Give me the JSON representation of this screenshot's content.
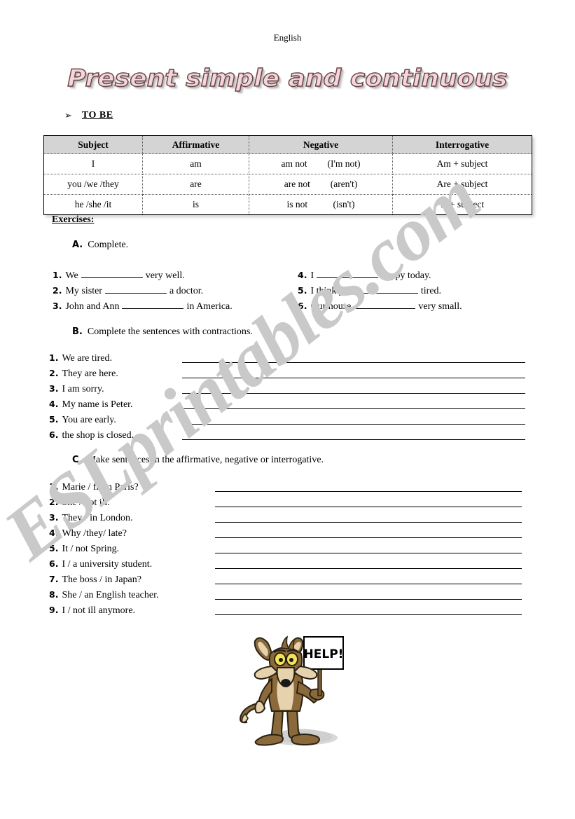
{
  "page": {
    "header_label": "English",
    "title": "Present simple and continuous",
    "watermark": "ESLprintables.com"
  },
  "grammar_section": {
    "bullet_glyph": "➢",
    "label": "TO BE",
    "table": {
      "headers": [
        "Subject",
        "Affirmative",
        "Negative",
        "Interrogative"
      ],
      "rows": [
        {
          "subject": "I",
          "affirmative": "am",
          "negative": "am not",
          "negative_contraction": "(I'm not)",
          "interrogative": "Am + subject"
        },
        {
          "subject": "you /we /they",
          "affirmative": "are",
          "negative": "are not",
          "negative_contraction": "(aren't)",
          "interrogative": "Are + subject"
        },
        {
          "subject": "he /she /it",
          "affirmative": "is",
          "negative": "is not",
          "negative_contraction": "(isn't)",
          "interrogative": "Is + subject"
        }
      ]
    }
  },
  "exercises": {
    "heading": "Exercises:",
    "section_a": {
      "letter": "A.",
      "instruction": "Complete.",
      "items_left": [
        {
          "num": "1.",
          "before": "We",
          "after": "very well."
        },
        {
          "num": "2.",
          "before": "My sister",
          "after": "a doctor."
        },
        {
          "num": "3.",
          "before": "John and Ann",
          "after": "in America."
        }
      ],
      "items_right": [
        {
          "num": "4.",
          "before": "I",
          "after": "happy today."
        },
        {
          "num": "5.",
          "before": "I think you",
          "after": "tired."
        },
        {
          "num": "6.",
          "before": "Our house",
          "after": "very small."
        }
      ]
    },
    "section_b": {
      "letter": "B.",
      "instruction": "Complete the sentences with contractions.",
      "items": [
        {
          "num": "1.",
          "text": "We are tired."
        },
        {
          "num": "2.",
          "text": "They are here."
        },
        {
          "num": "3.",
          "text": "I am sorry."
        },
        {
          "num": "4.",
          "text": "My name is Peter."
        },
        {
          "num": "5.",
          "text": "You are early."
        },
        {
          "num": "6.",
          "text": "the shop is closed."
        }
      ]
    },
    "section_c": {
      "letter": "C.",
      "instruction": "Make sentences in the affirmative, negative or interrogative.",
      "items": [
        {
          "num": "1.",
          "text": "Marie / from Paris?"
        },
        {
          "num": "2.",
          "text": "She / not ill."
        },
        {
          "num": "3.",
          "text": "They / in London."
        },
        {
          "num": "4.",
          "text": "Why /they/ late?"
        },
        {
          "num": "5.",
          "text": "It / not Spring."
        },
        {
          "num": "6.",
          "text": "I / a university student."
        },
        {
          "num": "7.",
          "text": "The boss / in Japan?"
        },
        {
          "num": "8.",
          "text": "She / an English teacher."
        },
        {
          "num": "9.",
          "text": "I / not ill anymore."
        }
      ]
    }
  },
  "illustration": {
    "name": "wile-e-coyote-holding-help-sign",
    "sign_text": "HELP!"
  },
  "colors": {
    "title_fill": "#f4d7da",
    "title_outline": "#6b4348",
    "table_header_bg": "#d4d4d4",
    "watermark": "#c9c9c9",
    "coyote_body": "#8a6a3a",
    "coyote_fur_light": "#e6d3ae"
  }
}
